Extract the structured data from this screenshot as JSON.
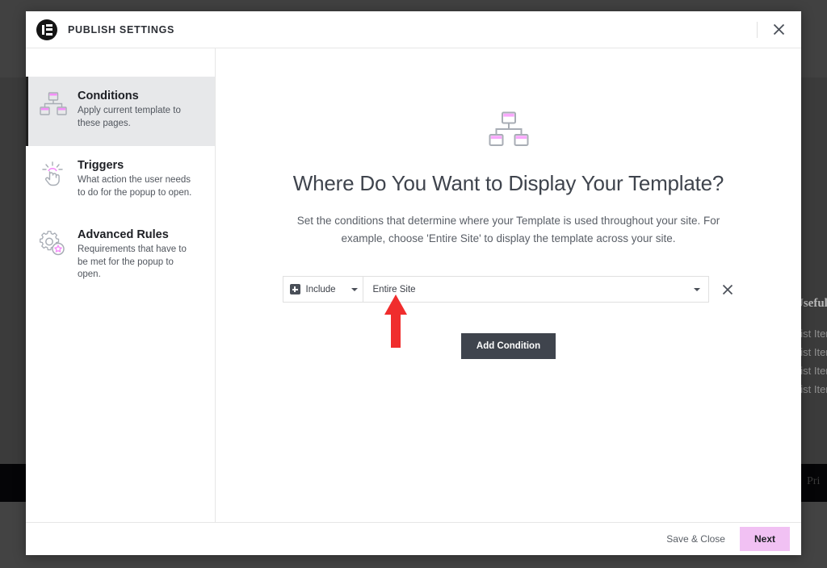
{
  "background": {
    "useful_heading": "Useful",
    "list_items": [
      "List Item",
      "List Item",
      "List Item",
      "List Item"
    ],
    "privacy_label": "Pri"
  },
  "modal": {
    "title": "PUBLISH SETTINGS",
    "logo_icon": "elementor-logo-icon",
    "close_icon": "close-icon",
    "sidebar": {
      "items": [
        {
          "label": "Conditions",
          "description": "Apply current template to these pages.",
          "icon": "sitemap-icon",
          "active": true
        },
        {
          "label": "Triggers",
          "description": "What action the user needs to do for the popup to open.",
          "icon": "click-hand-icon",
          "active": false
        },
        {
          "label": "Advanced Rules",
          "description": "Requirements that have to be met for the popup to open.",
          "icon": "gear-star-icon",
          "active": false
        }
      ]
    },
    "content": {
      "icon": "sitemap-icon",
      "title": "Where Do You Want to Display Your Template?",
      "subtitle": "Set the conditions that determine where your Template is used throughout your site. For example, choose 'Entire Site' to display the template across your site.",
      "condition_row": {
        "include_label": "Include",
        "include_icon": "plus-square-icon",
        "include_caret_icon": "chevron-down-icon",
        "target_value": "Entire Site",
        "target_caret_icon": "chevron-down-icon",
        "remove_icon": "close-icon"
      },
      "add_condition_label": "Add Condition",
      "annotation_icon": "red-arrow-up-icon"
    },
    "footer": {
      "save_close_label": "Save & Close",
      "next_label": "Next"
    }
  },
  "colors": {
    "accent_pink": "#f1c1f3",
    "icon_pink": "#f58ef9",
    "dark": "#3f444d",
    "annotation_red": "#f02d2d"
  }
}
